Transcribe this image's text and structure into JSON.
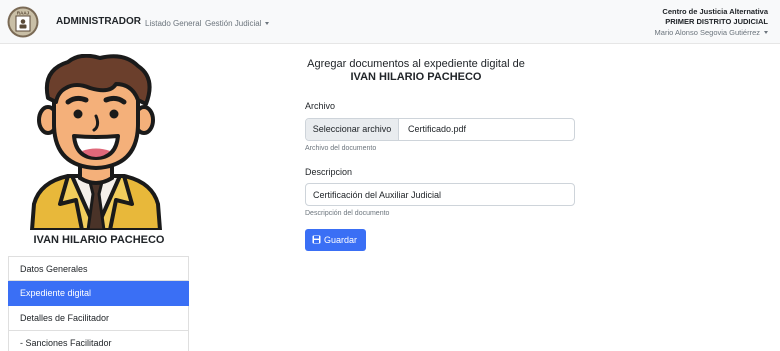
{
  "navbar": {
    "logo_text": "RAAJ",
    "brand": "ADMINISTRADOR",
    "links": [
      "Listado General",
      "Gestión Judicial"
    ],
    "org": "Centro de Justicia Alternativa",
    "district": "PRIMER DISTRITO JUDICIAL",
    "user": "Mario Alonso Segovia Gutiérrez"
  },
  "profile": {
    "name": "IVAN HILARIO PACHECO"
  },
  "sidebar": {
    "items": [
      {
        "label": "Datos Generales",
        "active": false
      },
      {
        "label": "Expediente digital",
        "active": true
      },
      {
        "label": "Detalles de Facilitador",
        "active": false
      },
      {
        "label": "- Sanciones Facilitador",
        "active": false
      }
    ]
  },
  "form": {
    "title_line1": "Agregar documentos al expediente digital de",
    "title_line2": "IVAN HILARIO PACHECO",
    "file_label": "Archivo",
    "file_button": "Seleccionar archivo",
    "file_name": "Certificado.pdf",
    "file_help": "Archivo del documento",
    "desc_label": "Descripcion",
    "desc_value": "Certificación del Auxiliar Judicial",
    "desc_help": "Descripción del documento",
    "save_label": "Guardar"
  },
  "colors": {
    "accent": "#3a6ff5",
    "navbar_bg": "#f8f9fa"
  }
}
